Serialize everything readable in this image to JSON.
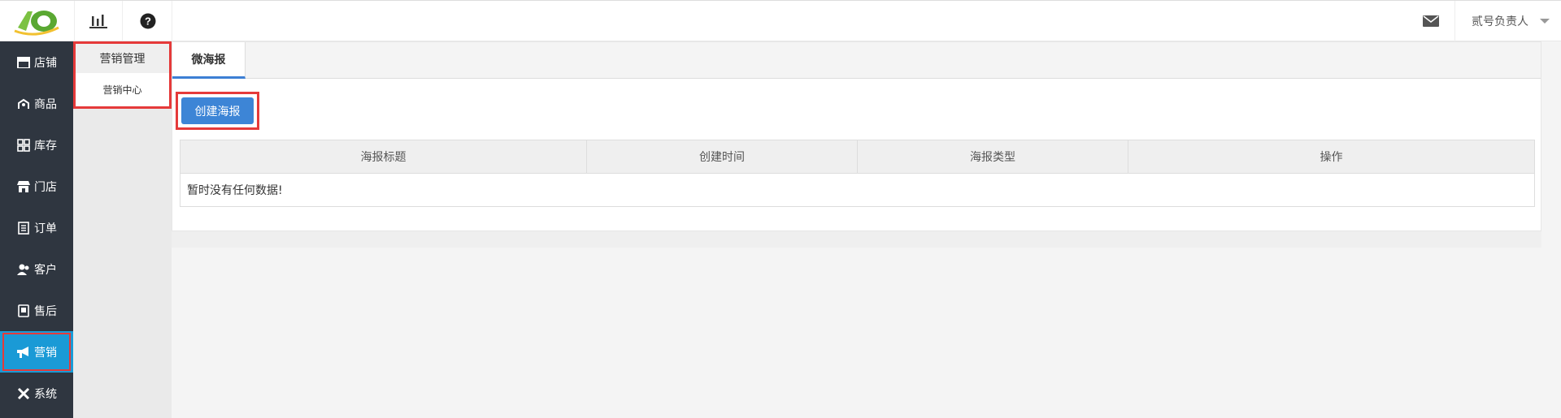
{
  "topbar": {
    "logo_icon": "brand-logo",
    "stats_icon": "bar-chart-icon",
    "help_icon": "help-circle-icon",
    "mail_icon": "mail-icon",
    "user_label": "贰号负责人"
  },
  "leftnav": {
    "items": [
      {
        "label": "店铺",
        "icon": "store-icon"
      },
      {
        "label": "商品",
        "icon": "goods-icon"
      },
      {
        "label": "库存",
        "icon": "inventory-icon"
      },
      {
        "label": "门店",
        "icon": "shop-front-icon"
      },
      {
        "label": "订单",
        "icon": "order-icon"
      },
      {
        "label": "客户",
        "icon": "customer-icon"
      },
      {
        "label": "售后",
        "icon": "after-sales-icon"
      },
      {
        "label": "营销",
        "icon": "megaphone-icon",
        "active": true
      },
      {
        "label": "系统",
        "icon": "tools-icon"
      }
    ]
  },
  "subnav": {
    "title": "营销管理",
    "items": [
      {
        "label": "营销中心"
      }
    ]
  },
  "main": {
    "tab_label": "微海报",
    "create_button": "创建海报",
    "table": {
      "columns": [
        "海报标题",
        "创建时间",
        "海报类型",
        "操作"
      ],
      "empty_text": "暂时没有任何数据!"
    }
  },
  "colors": {
    "nav_bg": "#2f3640",
    "nav_active": "#1a9ad6",
    "primary_button": "#3d85d6",
    "highlight_border": "#e53a3a",
    "tab_underline": "#3d7fd4"
  }
}
